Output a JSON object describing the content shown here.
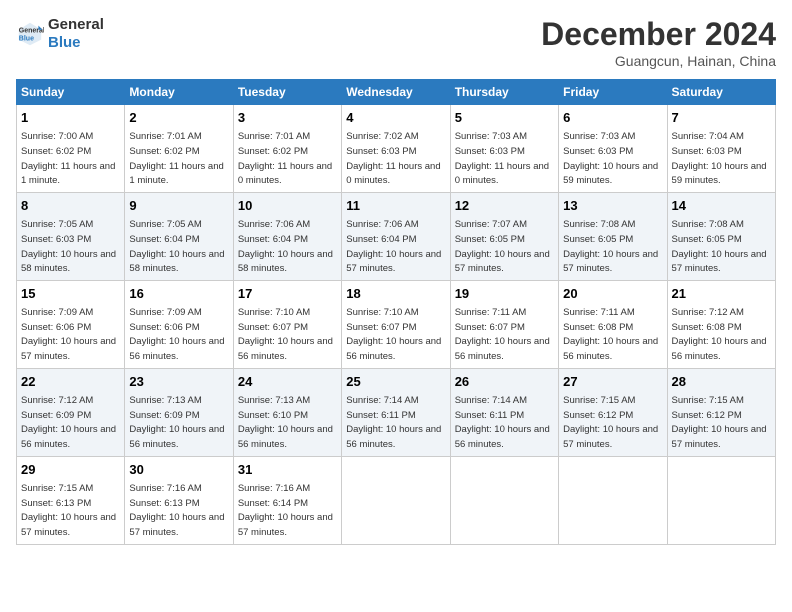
{
  "header": {
    "logo_line1": "General",
    "logo_line2": "Blue",
    "month": "December 2024",
    "location": "Guangcun, Hainan, China"
  },
  "days_of_week": [
    "Sunday",
    "Monday",
    "Tuesday",
    "Wednesday",
    "Thursday",
    "Friday",
    "Saturday"
  ],
  "weeks": [
    [
      {
        "num": "1",
        "rise": "7:00 AM",
        "set": "6:02 PM",
        "daylight": "11 hours and 1 minute."
      },
      {
        "num": "2",
        "rise": "7:01 AM",
        "set": "6:02 PM",
        "daylight": "11 hours and 1 minute."
      },
      {
        "num": "3",
        "rise": "7:01 AM",
        "set": "6:02 PM",
        "daylight": "11 hours and 0 minutes."
      },
      {
        "num": "4",
        "rise": "7:02 AM",
        "set": "6:03 PM",
        "daylight": "11 hours and 0 minutes."
      },
      {
        "num": "5",
        "rise": "7:03 AM",
        "set": "6:03 PM",
        "daylight": "11 hours and 0 minutes."
      },
      {
        "num": "6",
        "rise": "7:03 AM",
        "set": "6:03 PM",
        "daylight": "10 hours and 59 minutes."
      },
      {
        "num": "7",
        "rise": "7:04 AM",
        "set": "6:03 PM",
        "daylight": "10 hours and 59 minutes."
      }
    ],
    [
      {
        "num": "8",
        "rise": "7:05 AM",
        "set": "6:03 PM",
        "daylight": "10 hours and 58 minutes."
      },
      {
        "num": "9",
        "rise": "7:05 AM",
        "set": "6:04 PM",
        "daylight": "10 hours and 58 minutes."
      },
      {
        "num": "10",
        "rise": "7:06 AM",
        "set": "6:04 PM",
        "daylight": "10 hours and 58 minutes."
      },
      {
        "num": "11",
        "rise": "7:06 AM",
        "set": "6:04 PM",
        "daylight": "10 hours and 57 minutes."
      },
      {
        "num": "12",
        "rise": "7:07 AM",
        "set": "6:05 PM",
        "daylight": "10 hours and 57 minutes."
      },
      {
        "num": "13",
        "rise": "7:08 AM",
        "set": "6:05 PM",
        "daylight": "10 hours and 57 minutes."
      },
      {
        "num": "14",
        "rise": "7:08 AM",
        "set": "6:05 PM",
        "daylight": "10 hours and 57 minutes."
      }
    ],
    [
      {
        "num": "15",
        "rise": "7:09 AM",
        "set": "6:06 PM",
        "daylight": "10 hours and 57 minutes."
      },
      {
        "num": "16",
        "rise": "7:09 AM",
        "set": "6:06 PM",
        "daylight": "10 hours and 56 minutes."
      },
      {
        "num": "17",
        "rise": "7:10 AM",
        "set": "6:07 PM",
        "daylight": "10 hours and 56 minutes."
      },
      {
        "num": "18",
        "rise": "7:10 AM",
        "set": "6:07 PM",
        "daylight": "10 hours and 56 minutes."
      },
      {
        "num": "19",
        "rise": "7:11 AM",
        "set": "6:07 PM",
        "daylight": "10 hours and 56 minutes."
      },
      {
        "num": "20",
        "rise": "7:11 AM",
        "set": "6:08 PM",
        "daylight": "10 hours and 56 minutes."
      },
      {
        "num": "21",
        "rise": "7:12 AM",
        "set": "6:08 PM",
        "daylight": "10 hours and 56 minutes."
      }
    ],
    [
      {
        "num": "22",
        "rise": "7:12 AM",
        "set": "6:09 PM",
        "daylight": "10 hours and 56 minutes."
      },
      {
        "num": "23",
        "rise": "7:13 AM",
        "set": "6:09 PM",
        "daylight": "10 hours and 56 minutes."
      },
      {
        "num": "24",
        "rise": "7:13 AM",
        "set": "6:10 PM",
        "daylight": "10 hours and 56 minutes."
      },
      {
        "num": "25",
        "rise": "7:14 AM",
        "set": "6:11 PM",
        "daylight": "10 hours and 56 minutes."
      },
      {
        "num": "26",
        "rise": "7:14 AM",
        "set": "6:11 PM",
        "daylight": "10 hours and 56 minutes."
      },
      {
        "num": "27",
        "rise": "7:15 AM",
        "set": "6:12 PM",
        "daylight": "10 hours and 57 minutes."
      },
      {
        "num": "28",
        "rise": "7:15 AM",
        "set": "6:12 PM",
        "daylight": "10 hours and 57 minutes."
      }
    ],
    [
      {
        "num": "29",
        "rise": "7:15 AM",
        "set": "6:13 PM",
        "daylight": "10 hours and 57 minutes."
      },
      {
        "num": "30",
        "rise": "7:16 AM",
        "set": "6:13 PM",
        "daylight": "10 hours and 57 minutes."
      },
      {
        "num": "31",
        "rise": "7:16 AM",
        "set": "6:14 PM",
        "daylight": "10 hours and 57 minutes."
      },
      null,
      null,
      null,
      null
    ]
  ]
}
